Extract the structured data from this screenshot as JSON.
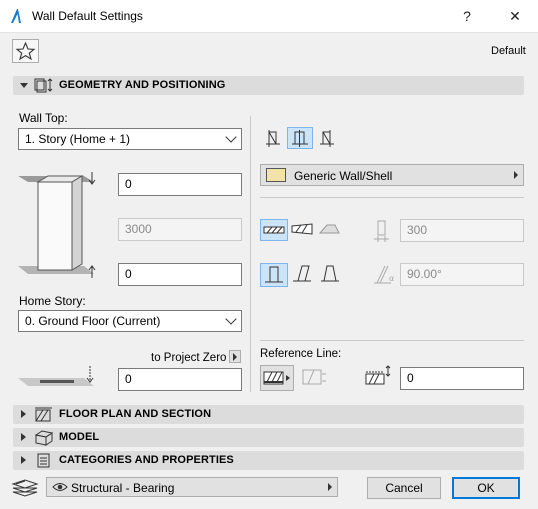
{
  "window": {
    "title": "Wall Default Settings",
    "help_label": "?",
    "close_label": "✕"
  },
  "header": {
    "favorites_icon": "star-icon",
    "default_label": "Default"
  },
  "sections": {
    "geometry": "GEOMETRY AND POSITIONING",
    "floor_plan": "FLOOR PLAN AND SECTION",
    "model": "MODEL",
    "categories": "CATEGORIES AND PROPERTIES"
  },
  "geometry": {
    "wall_top_label": "Wall Top:",
    "wall_top_value": "1. Story (Home + 1)",
    "top_offset": "0",
    "height": "3000",
    "bottom_offset": "0",
    "home_story_label": "Home Story:",
    "home_story_value": "0. Ground Floor (Current)",
    "to_project_zero_label": "to Project Zero",
    "project_zero_value": "0",
    "building_material": "Generic Wall/Shell",
    "thickness": "300",
    "slant_angle": "90.00°",
    "reference_line_label": "Reference Line:",
    "reference_offset": "0"
  },
  "footer": {
    "structural_function": "Structural - Bearing",
    "cancel_label": "Cancel",
    "ok_label": "OK"
  },
  "colors": {
    "accent": "#0078d7",
    "selected_bg": "#cce4f7",
    "section_bg": "#dcdcdc",
    "material_swatch": "#f2e3a8"
  }
}
